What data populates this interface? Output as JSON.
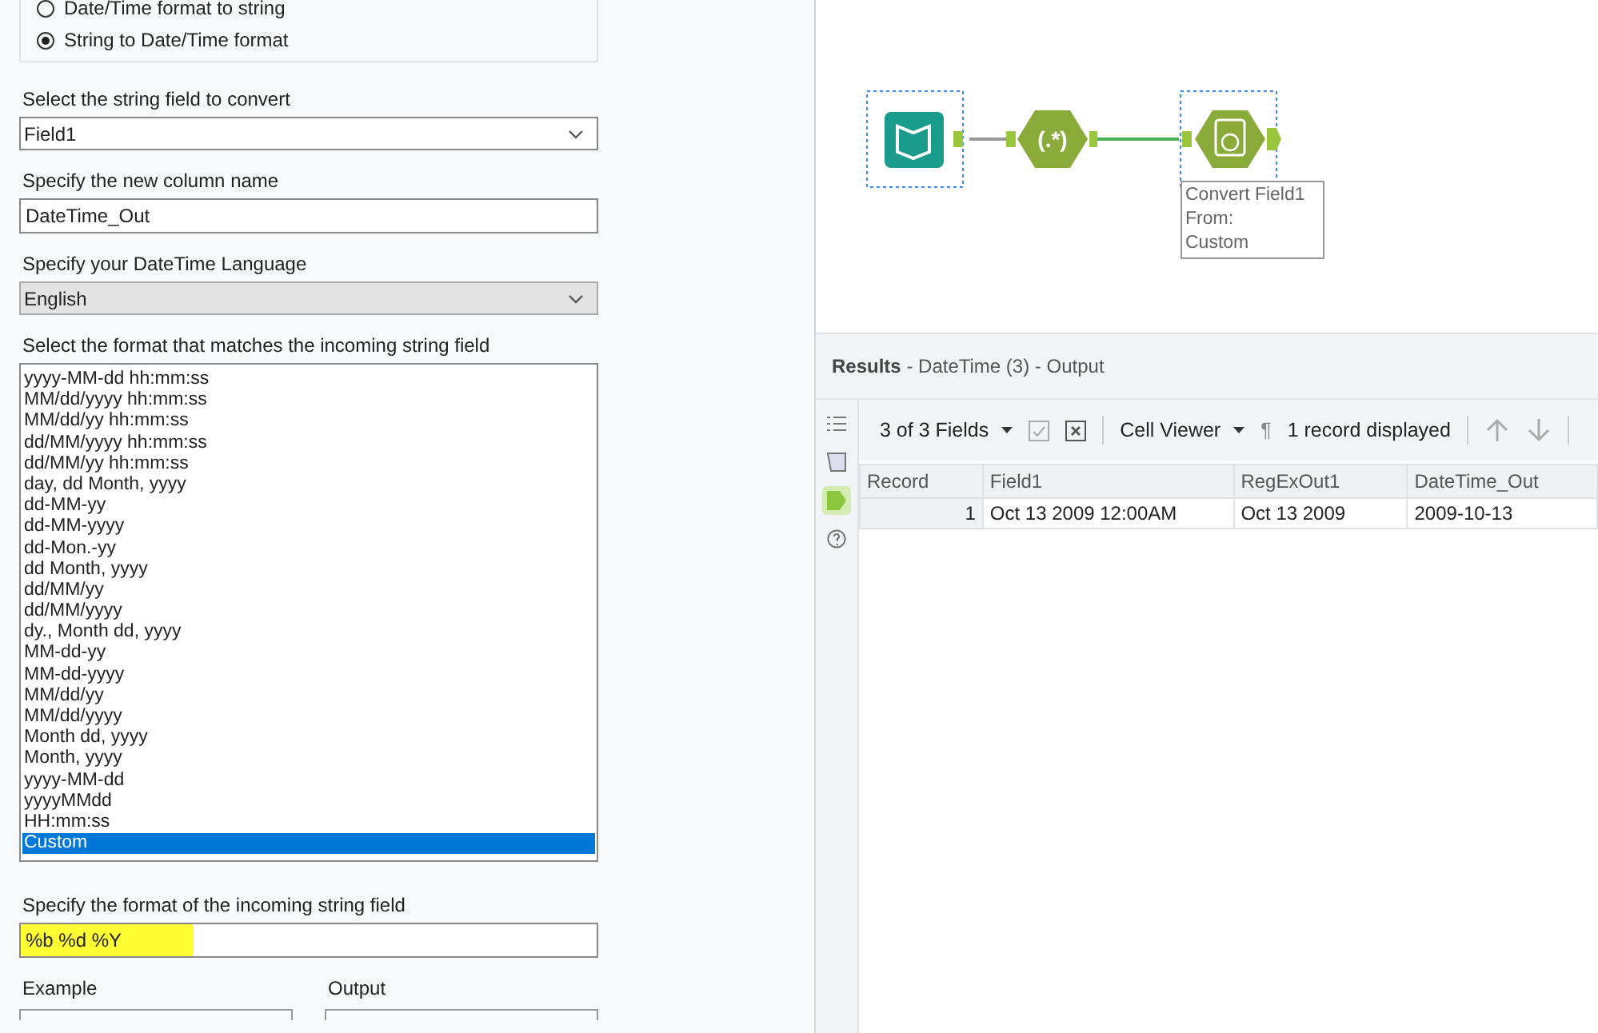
{
  "conversion": {
    "options": [
      {
        "label": "Date/Time format to string",
        "selected": false
      },
      {
        "label": "String to Date/Time format",
        "selected": true
      }
    ]
  },
  "string_field": {
    "label": "Select the string field to convert",
    "value": "Field1",
    "disabled": false
  },
  "column_name": {
    "label": "Specify the new column name",
    "value": "DateTime_Out"
  },
  "language": {
    "label": "Specify your DateTime Language",
    "value": "English",
    "disabled": true
  },
  "format_list": {
    "label": "Select the format that matches the incoming string field",
    "items": [
      {
        "label": "yyyy-MM-dd hh:mm:ss",
        "selected": false
      },
      {
        "label": "MM/dd/yyyy hh:mm:ss",
        "selected": false
      },
      {
        "label": "MM/dd/yy hh:mm:ss",
        "selected": false
      },
      {
        "label": "dd/MM/yyyy hh:mm:ss",
        "selected": false
      },
      {
        "label": "dd/MM/yy hh:mm:ss",
        "selected": false
      },
      {
        "label": "day, dd Month, yyyy",
        "selected": false
      },
      {
        "label": "dd-MM-yy",
        "selected": false
      },
      {
        "label": "dd-MM-yyyy",
        "selected": false
      },
      {
        "label": "dd-Mon.-yy",
        "selected": false
      },
      {
        "label": "dd Month, yyyy",
        "selected": false
      },
      {
        "label": "dd/MM/yy",
        "selected": false
      },
      {
        "label": "dd/MM/yyyy",
        "selected": false
      },
      {
        "label": "dy., Month dd, yyyy",
        "selected": false
      },
      {
        "label": "MM-dd-yy",
        "selected": false
      },
      {
        "label": "MM-dd-yyyy",
        "selected": false
      },
      {
        "label": "MM/dd/yy",
        "selected": false
      },
      {
        "label": "MM/dd/yyyy",
        "selected": false
      },
      {
        "label": "Month dd, yyyy",
        "selected": false
      },
      {
        "label": "Month, yyyy",
        "selected": false
      },
      {
        "label": "yyyy-MM-dd",
        "selected": false
      },
      {
        "label": "yyyyMMdd",
        "selected": false
      },
      {
        "label": "HH:mm:ss",
        "selected": false
      },
      {
        "label": "Custom",
        "selected": true
      }
    ]
  },
  "custom_format": {
    "label": "Specify the format of the incoming string field",
    "value": "%b %d %Y",
    "highlighted": true
  },
  "example_label": "Example",
  "output_label": "Output",
  "canvas": {
    "annotation": [
      "Convert Field1",
      "From:",
      "Custom"
    ],
    "regex_label": "(.*)"
  },
  "results": {
    "title": "Results",
    "subtitle": " - DateTime (3) - Output",
    "fields": "3 of 3 Fields",
    "viewer": "Cell Viewer",
    "pilcrow": "¶",
    "count": "1 record displayed",
    "side_tabs": [
      {
        "kind": "list",
        "selected": false
      },
      {
        "kind": "config",
        "selected": false
      },
      {
        "kind": "output",
        "selected": true
      },
      {
        "kind": "help",
        "selected": false
      }
    ],
    "columns": [
      "Record",
      "Field1",
      "RegExOut1",
      "DateTime_Out"
    ],
    "rows": [
      [
        "1",
        "Oct 13 2009 12:00AM",
        "Oct 13 2009",
        "2009-10-13"
      ]
    ]
  }
}
